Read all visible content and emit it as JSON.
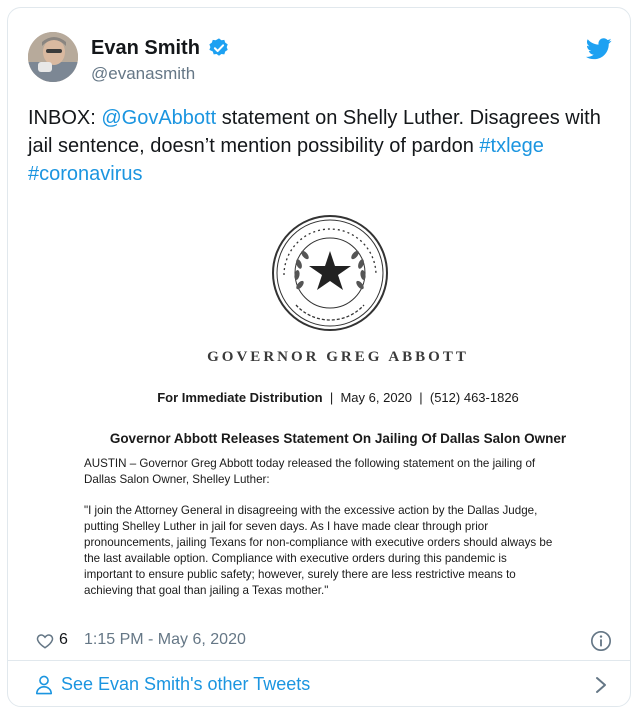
{
  "author": {
    "display_name": "Evan Smith",
    "handle": "@evanasmith",
    "verified_icon": "verified-badge-icon",
    "platform_icon": "twitter-bird-icon"
  },
  "tweet": {
    "prefix": "INBOX: ",
    "mention": "@GovAbbott",
    "text": " statement on Shelly Luther. Disagrees with jail sentence, doesn’t mention possibility of pardon ",
    "hashtag1": "#txlege",
    "hashtag2": "#coronavirus"
  },
  "image": {
    "seal_text": "THE STATE OF TEXAS · GOVERNOR",
    "governor_title": "GOVERNOR GREG ABBOTT",
    "distribution_label": "For Immediate Distribution",
    "date": "May 6, 2020",
    "phone": "(512) 463-1826",
    "headline": "Governor Abbott Releases Statement On Jailing Of Dallas Salon Owner",
    "lines_intro": [
      "AUSTIN – Governor Greg Abbott today released the following statement on the jailing of",
      "Dallas Salon Owner, Shelley Luther:"
    ],
    "lines_quote": [
      "\"I join the Attorney General in disagreeing with the excessive action by the Dallas Judge,",
      "putting Shelley Luther in jail for seven days. As I have made clear through prior",
      "pronouncements, jailing Texans for non-compliance with executive orders should always be",
      "the last available option. Compliance with executive orders during this pandemic is",
      "important to ensure public safety; however, surely there are less restrictive means to",
      "achieving that goal than jailing a Texas mother.\""
    ]
  },
  "meta": {
    "likes": "6",
    "timestamp": "1:15 PM - May 6, 2020"
  },
  "footer": {
    "label": "See Evan Smith's other Tweets"
  },
  "colors": {
    "link": "#1b95e0",
    "muted": "#657786",
    "border": "#e1e8ed"
  }
}
